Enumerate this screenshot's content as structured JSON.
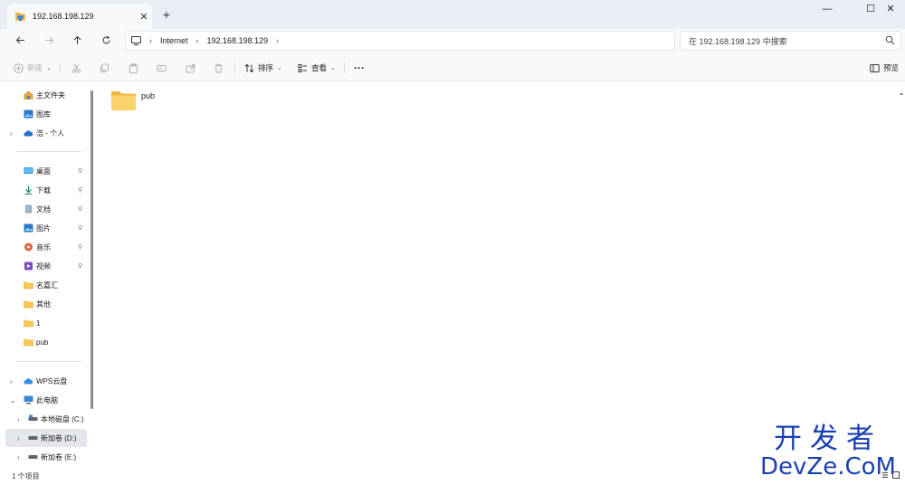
{
  "tab": {
    "title": "192.168.198.129",
    "close": "✕",
    "new": "+"
  },
  "window_controls": {
    "minimize": "—",
    "maximize": "☐",
    "close": "✕"
  },
  "navigation": {
    "breadcrumb": [
      "Internet",
      "192.168.198.129"
    ],
    "search_placeholder": "在 192.168.198.129 中搜索"
  },
  "toolbar": {
    "new_label": "新建",
    "sort_label": "排序",
    "view_label": "查看",
    "more_label": "···",
    "preview_label": "预览"
  },
  "sidebar": {
    "quick": [
      {
        "label": "主文件夹",
        "icon": "home-icon"
      },
      {
        "label": "图库",
        "icon": "gallery-icon"
      },
      {
        "label": "浩 - 个人",
        "icon": "cloud-icon"
      }
    ],
    "pinned": [
      {
        "label": "桌面",
        "icon": "desktop-icon"
      },
      {
        "label": "下载",
        "icon": "download-icon"
      },
      {
        "label": "文档",
        "icon": "document-icon"
      },
      {
        "label": "图片",
        "icon": "pictures-icon"
      },
      {
        "label": "音乐",
        "icon": "music-icon"
      },
      {
        "label": "视频",
        "icon": "video-icon"
      },
      {
        "label": "名嘉汇",
        "icon": "folder-icon"
      },
      {
        "label": "其他",
        "icon": "folder-icon"
      },
      {
        "label": "1",
        "icon": "folder-icon"
      },
      {
        "label": "pub",
        "icon": "folder-icon"
      }
    ],
    "pin_glyph": "📌",
    "devices": [
      {
        "label": "WPS云盘",
        "icon": "cloud-icon"
      },
      {
        "label": "此电脑",
        "icon": "computer-icon"
      },
      {
        "label": "本地磁盘 (C:)",
        "icon": "drive-icon"
      },
      {
        "label": "新加卷 (D:)",
        "icon": "drive-icon"
      },
      {
        "label": "新加卷 (E:)",
        "icon": "drive-icon"
      }
    ]
  },
  "content": {
    "items": [
      {
        "name": "pub",
        "icon": "folder-icon"
      }
    ]
  },
  "status": {
    "text": "1 个项目"
  },
  "watermark": {
    "cn": "开发者",
    "en": "DevZe.CoM"
  },
  "colors": {
    "accent": "#0067c0",
    "folder": "#f8c954",
    "watermark": "#1b3fb2"
  }
}
